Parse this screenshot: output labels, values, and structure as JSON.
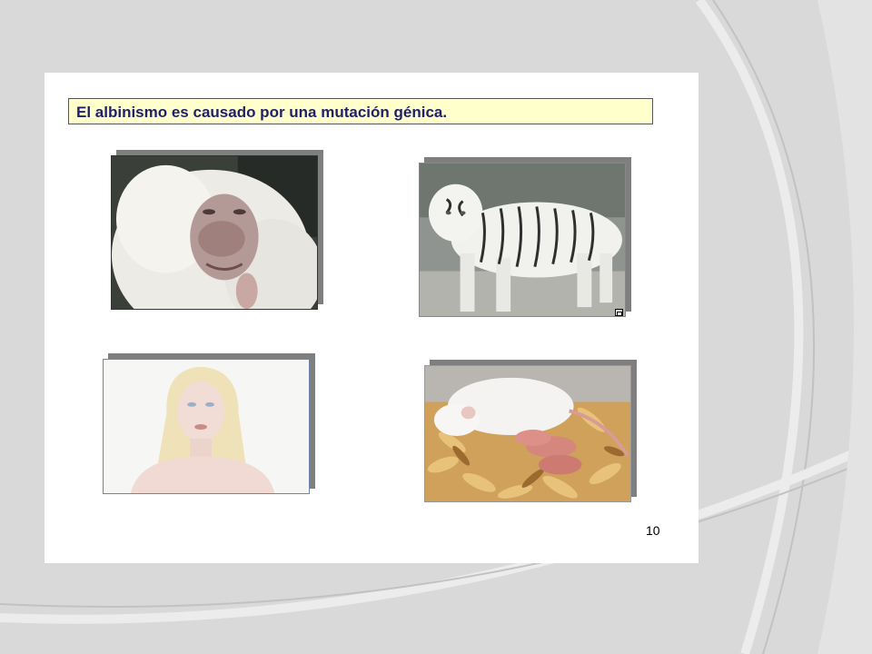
{
  "slide": {
    "title": "El albinismo es causado por una mutación génica.",
    "page_number": "10",
    "title_background": "#ffffcc",
    "title_color": "#1f1f6b"
  },
  "images": [
    {
      "name": "albino-gorilla-photo",
      "subject": "albino gorilla"
    },
    {
      "name": "white-tiger-photo",
      "subject": "white tiger"
    },
    {
      "name": "albino-person-photo",
      "subject": "albino person"
    },
    {
      "name": "albino-rat-photo",
      "subject": "albino rat with pups"
    }
  ],
  "colors": {
    "background": "#d9d9d9",
    "slide": "#ffffff",
    "shadow": "#7f7f7f"
  }
}
